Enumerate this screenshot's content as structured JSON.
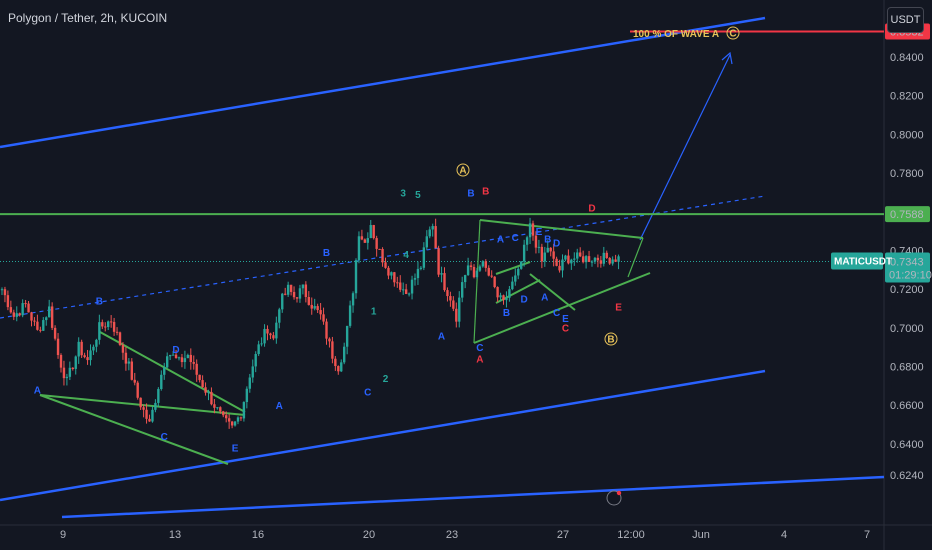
{
  "header": {
    "symbol_title": "Polygon / Tether, 2h, KUCOIN",
    "currency": "USDT"
  },
  "colors": {
    "background": "#131722",
    "up": "#26a69a",
    "down": "#ef5350",
    "channel": "#2962ff",
    "wedge": "#4caf50",
    "resistance_line": "#4caf50",
    "target_line": "#f23645",
    "wave_blue": "#2962ff",
    "wave_green": "#26a69a",
    "wave_red": "#f23645",
    "circle_label": "#e8c35a"
  },
  "annotations": {
    "wave_text": "100 % OF WAVE A",
    "wave_circle_c": "C",
    "circle_A": "A",
    "circle_B": "B"
  },
  "price_tags": {
    "target": "0.8532",
    "resistance": "0.7588",
    "ticker_name": "MATICUSDT",
    "current": "0.7343",
    "countdown": "01:29:10"
  },
  "chart_data": {
    "type": "candlestick",
    "title": "Polygon / Tether, 2h, KUCOIN",
    "ylim": [
      0.618,
      0.876
    ],
    "y_ticks": [
      "0.8400",
      "0.8200",
      "0.8000",
      "0.7800",
      "0.7600",
      "0.7400",
      "0.7200",
      "0.7000",
      "0.6800",
      "0.6600",
      "0.6400",
      "0.6240"
    ],
    "x_ticks": [
      "9",
      "13",
      "16",
      "20",
      "23",
      "27",
      "12:00",
      "Jun",
      "4",
      "7"
    ],
    "horizontal_levels": [
      {
        "value": 0.8532,
        "label": "0.8532"
      },
      {
        "value": 0.7588,
        "label": "0.7588"
      }
    ],
    "last_price": 0.7343,
    "path": [
      [
        0,
        0.72
      ],
      [
        4,
        0.706
      ],
      [
        8,
        0.712
      ],
      [
        12,
        0.698
      ],
      [
        16,
        0.71
      ],
      [
        19,
        0.686
      ],
      [
        22,
        0.672
      ],
      [
        26,
        0.69
      ],
      [
        29,
        0.683
      ],
      [
        33,
        0.7
      ],
      [
        37,
        0.704
      ],
      [
        40,
        0.692
      ],
      [
        43,
        0.68
      ],
      [
        46,
        0.664
      ],
      [
        50,
        0.65
      ],
      [
        53,
        0.67
      ],
      [
        56,
        0.688
      ],
      [
        60,
        0.682
      ],
      [
        63,
        0.686
      ],
      [
        66,
        0.676
      ],
      [
        69,
        0.668
      ],
      [
        72,
        0.66
      ],
      [
        75,
        0.652
      ],
      [
        78,
        0.648
      ],
      [
        81,
        0.656
      ],
      [
        84,
        0.676
      ],
      [
        87,
        0.69
      ],
      [
        90,
        0.7
      ],
      [
        92,
        0.694
      ],
      [
        94,
        0.712
      ],
      [
        97,
        0.72
      ],
      [
        99,
        0.716
      ],
      [
        102,
        0.72
      ],
      [
        105,
        0.712
      ],
      [
        108,
        0.706
      ],
      [
        110,
        0.696
      ],
      [
        112,
        0.686
      ],
      [
        114,
        0.68
      ],
      [
        116,
        0.69
      ],
      [
        117,
        0.699
      ],
      [
        119,
        0.72
      ],
      [
        121,
        0.75
      ],
      [
        123,
        0.744
      ],
      [
        125,
        0.754
      ],
      [
        127,
        0.742
      ],
      [
        129,
        0.736
      ],
      [
        131,
        0.73
      ],
      [
        134,
        0.724
      ],
      [
        137,
        0.718
      ],
      [
        140,
        0.726
      ],
      [
        142,
        0.732
      ],
      [
        144,
        0.746
      ],
      [
        146,
        0.754
      ],
      [
        148,
        0.73
      ],
      [
        150,
        0.722
      ],
      [
        152,
        0.716
      ],
      [
        154,
        0.706
      ],
      [
        156,
        0.724
      ],
      [
        158,
        0.732
      ],
      [
        160,
        0.726
      ],
      [
        162,
        0.734
      ],
      [
        164,
        0.73
      ],
      [
        166,
        0.724
      ],
      [
        168,
        0.716
      ],
      [
        170,
        0.712
      ],
      [
        172,
        0.72
      ],
      [
        175,
        0.728
      ],
      [
        177,
        0.74
      ],
      [
        179,
        0.752
      ],
      [
        181,
        0.744
      ],
      [
        183,
        0.734
      ],
      [
        185,
        0.742
      ],
      [
        187,
        0.734
      ],
      [
        189,
        0.73
      ],
      [
        191,
        0.736
      ]
    ],
    "wave_labels": [
      {
        "text": "B",
        "i": 33,
        "p": 0.712,
        "color": "blue"
      },
      {
        "text": "A",
        "i": 12,
        "p": 0.666,
        "color": "blue"
      },
      {
        "text": "C",
        "i": 55,
        "p": 0.642,
        "color": "blue"
      },
      {
        "text": "D",
        "i": 59,
        "p": 0.687,
        "color": "blue"
      },
      {
        "text": "E",
        "i": 79,
        "p": 0.636,
        "color": "blue"
      },
      {
        "text": "A",
        "i": 94,
        "p": 0.658,
        "color": "blue"
      },
      {
        "text": "B",
        "i": 110,
        "p": 0.737,
        "color": "blue"
      },
      {
        "text": "1",
        "i": 126,
        "p": 0.707,
        "color": "green"
      },
      {
        "text": "C",
        "i": 124,
        "p": 0.665,
        "color": "blue"
      },
      {
        "text": "2",
        "i": 130,
        "p": 0.672,
        "color": "green"
      },
      {
        "text": "3",
        "i": 136,
        "p": 0.768,
        "color": "green"
      },
      {
        "text": "5",
        "i": 141,
        "p": 0.767,
        "color": "green"
      },
      {
        "text": "4",
        "i": 137,
        "p": 0.736,
        "color": "green"
      },
      {
        "text": "A",
        "i": 149,
        "p": 0.694,
        "color": "blue"
      },
      {
        "text": "B",
        "i": 159,
        "p": 0.768,
        "color": "blue"
      },
      {
        "text": "B",
        "i": 164,
        "p": 0.769,
        "color": "red"
      },
      {
        "text": "C",
        "i": 162,
        "p": 0.688,
        "color": "blue"
      },
      {
        "text": "A",
        "i": 162,
        "p": 0.682,
        "color": "red"
      },
      {
        "text": "A",
        "i": 169,
        "p": 0.744,
        "color": "blue"
      },
      {
        "text": "C",
        "i": 174,
        "p": 0.745,
        "color": "blue"
      },
      {
        "text": "E",
        "i": 182,
        "p": 0.748,
        "color": "blue"
      },
      {
        "text": "B",
        "i": 185,
        "p": 0.744,
        "color": "blue"
      },
      {
        "text": "D",
        "i": 188,
        "p": 0.742,
        "color": "blue"
      },
      {
        "text": "B",
        "i": 171,
        "p": 0.706,
        "color": "blue"
      },
      {
        "text": "D",
        "i": 177,
        "p": 0.713,
        "color": "blue"
      },
      {
        "text": "A",
        "i": 184,
        "p": 0.714,
        "color": "blue"
      },
      {
        "text": "C",
        "i": 188,
        "p": 0.706,
        "color": "blue"
      },
      {
        "text": "E",
        "i": 191,
        "p": 0.703,
        "color": "blue"
      },
      {
        "text": "C",
        "i": 191,
        "p": 0.698,
        "color": "red"
      },
      {
        "text": "D",
        "i": 200,
        "p": 0.76,
        "color": "red"
      },
      {
        "text": "E",
        "i": 209,
        "p": 0.709,
        "color": "red"
      }
    ]
  }
}
